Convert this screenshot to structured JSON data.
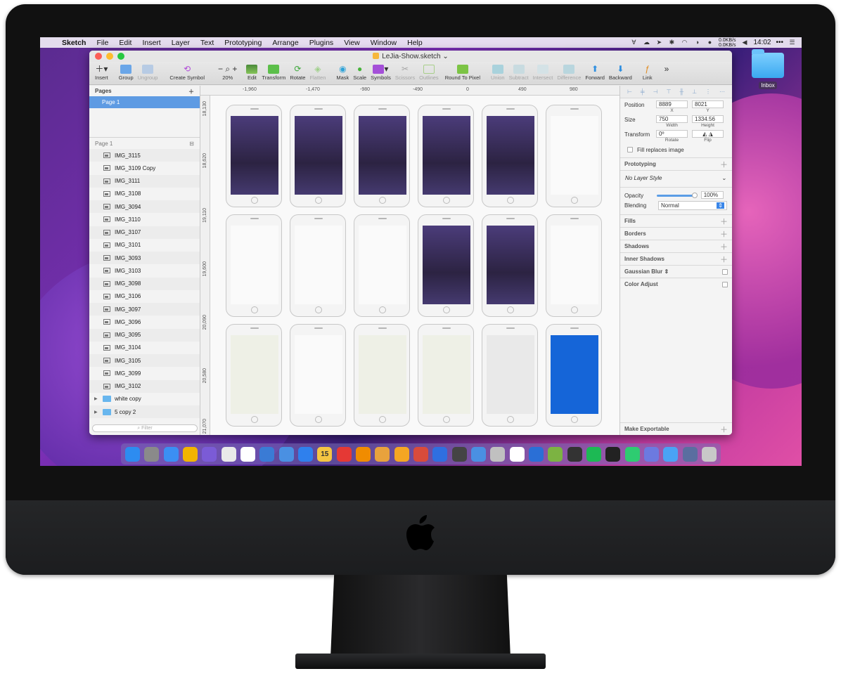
{
  "menubar": {
    "app": "Sketch",
    "items": [
      "File",
      "Edit",
      "Insert",
      "Layer",
      "Text",
      "Prototyping",
      "Arrange",
      "Plugins",
      "View",
      "Window",
      "Help"
    ],
    "net_up": "0.0KB/s",
    "net_down": "0.0KB/s",
    "time": "14:02",
    "more": "•••"
  },
  "desktop": {
    "folder_label": "Inbox"
  },
  "window": {
    "title": "LeJia-Show.sketch"
  },
  "toolbar": {
    "insert": "Insert",
    "group": "Group",
    "ungroup": "Ungroup",
    "create_symbol": "Create Symbol",
    "zoom": "20%",
    "edit": "Edit",
    "transform": "Transform",
    "rotate": "Rotate",
    "flatten": "Flatten",
    "mask": "Mask",
    "scale": "Scale",
    "symbols": "Symbols",
    "scissors": "Scissors",
    "outlines": "Outlines",
    "round_to_pixel": "Round To Pixel",
    "union": "Union",
    "subtract": "Subtract",
    "intersect": "Intersect",
    "difference": "Difference",
    "forward": "Forward",
    "backward": "Backward",
    "link": "Link"
  },
  "pages_panel": {
    "header": "Pages",
    "selected_page": "Page 1"
  },
  "layers_panel": {
    "header": "Page 1",
    "layers": [
      "IMG_3115",
      "IMG_3109 Copy",
      "IMG_3111",
      "IMG_3108",
      "IMG_3094",
      "IMG_3110",
      "IMG_3107",
      "IMG_3101",
      "IMG_3093",
      "IMG_3103",
      "IMG_3098",
      "IMG_3106",
      "IMG_3097",
      "IMG_3096",
      "IMG_3095",
      "IMG_3104",
      "IMG_3105",
      "IMG_3099",
      "IMG_3102"
    ],
    "groups": [
      "white copy",
      "5 copy 2"
    ],
    "filter_placeholder": "Filter"
  },
  "rulers": {
    "top": [
      "-1,960",
      "-1,470",
      "-980",
      "-490",
      "0",
      "490",
      "980"
    ],
    "left": [
      "18,130",
      "18,620",
      "19,110",
      "19,600",
      "20,090",
      "20,580",
      "21,070"
    ]
  },
  "inspector": {
    "position_label": "Position",
    "x": "8889",
    "y": "8021",
    "x_label": "X",
    "y_label": "Y",
    "size_label": "Size",
    "width": "750",
    "height": "1334.56",
    "width_label": "Width",
    "height_label": "Height",
    "transform_label": "Transform",
    "rotate": "0º",
    "rotate_label": "Rotate",
    "flip_label": "Flip",
    "fill_replaces": "Fill replaces image",
    "prototyping": "Prototyping",
    "layer_style": "No Layer Style",
    "opacity_label": "Opacity",
    "opacity": "100%",
    "blending_label": "Blending",
    "blending": "Normal",
    "fills": "Fills",
    "borders": "Borders",
    "shadows": "Shadows",
    "inner_shadows": "Inner Shadows",
    "gaussian_blur": "Gaussian Blur",
    "color_adjust": "Color Adjust",
    "make_exportable": "Make Exportable"
  },
  "artboards": {
    "screen_styles": [
      "purple",
      "purple",
      "purple",
      "purple",
      "purple",
      "white",
      "white",
      "white",
      "white",
      "purple",
      "purple",
      "white",
      "map",
      "white",
      "map",
      "map",
      "gray",
      "blue"
    ]
  },
  "dock": {
    "colors": [
      "#2d8cf0",
      "#8a8a8a",
      "#3b8ff3",
      "#f2b400",
      "#7b5bd6",
      "#e9e9e9",
      "#ffffff",
      "#3a7bd5",
      "#4a90e2",
      "#2f80ed",
      "#f5c542",
      "#e53935",
      "#f08c00",
      "#e8a23d",
      "#f5a623",
      "#d94b3b",
      "#2f6fe0",
      "#444",
      "#4a90e2",
      "#c0c0c0",
      "#ffffff",
      "#2a6fd6",
      "#7cb342",
      "#333",
      "#1db954",
      "#222",
      "#2ecc71",
      "#6c7ae0",
      "#4aa3f5",
      "#5a6ea0",
      "#c8c8c8"
    ],
    "calendar_day": "15"
  }
}
